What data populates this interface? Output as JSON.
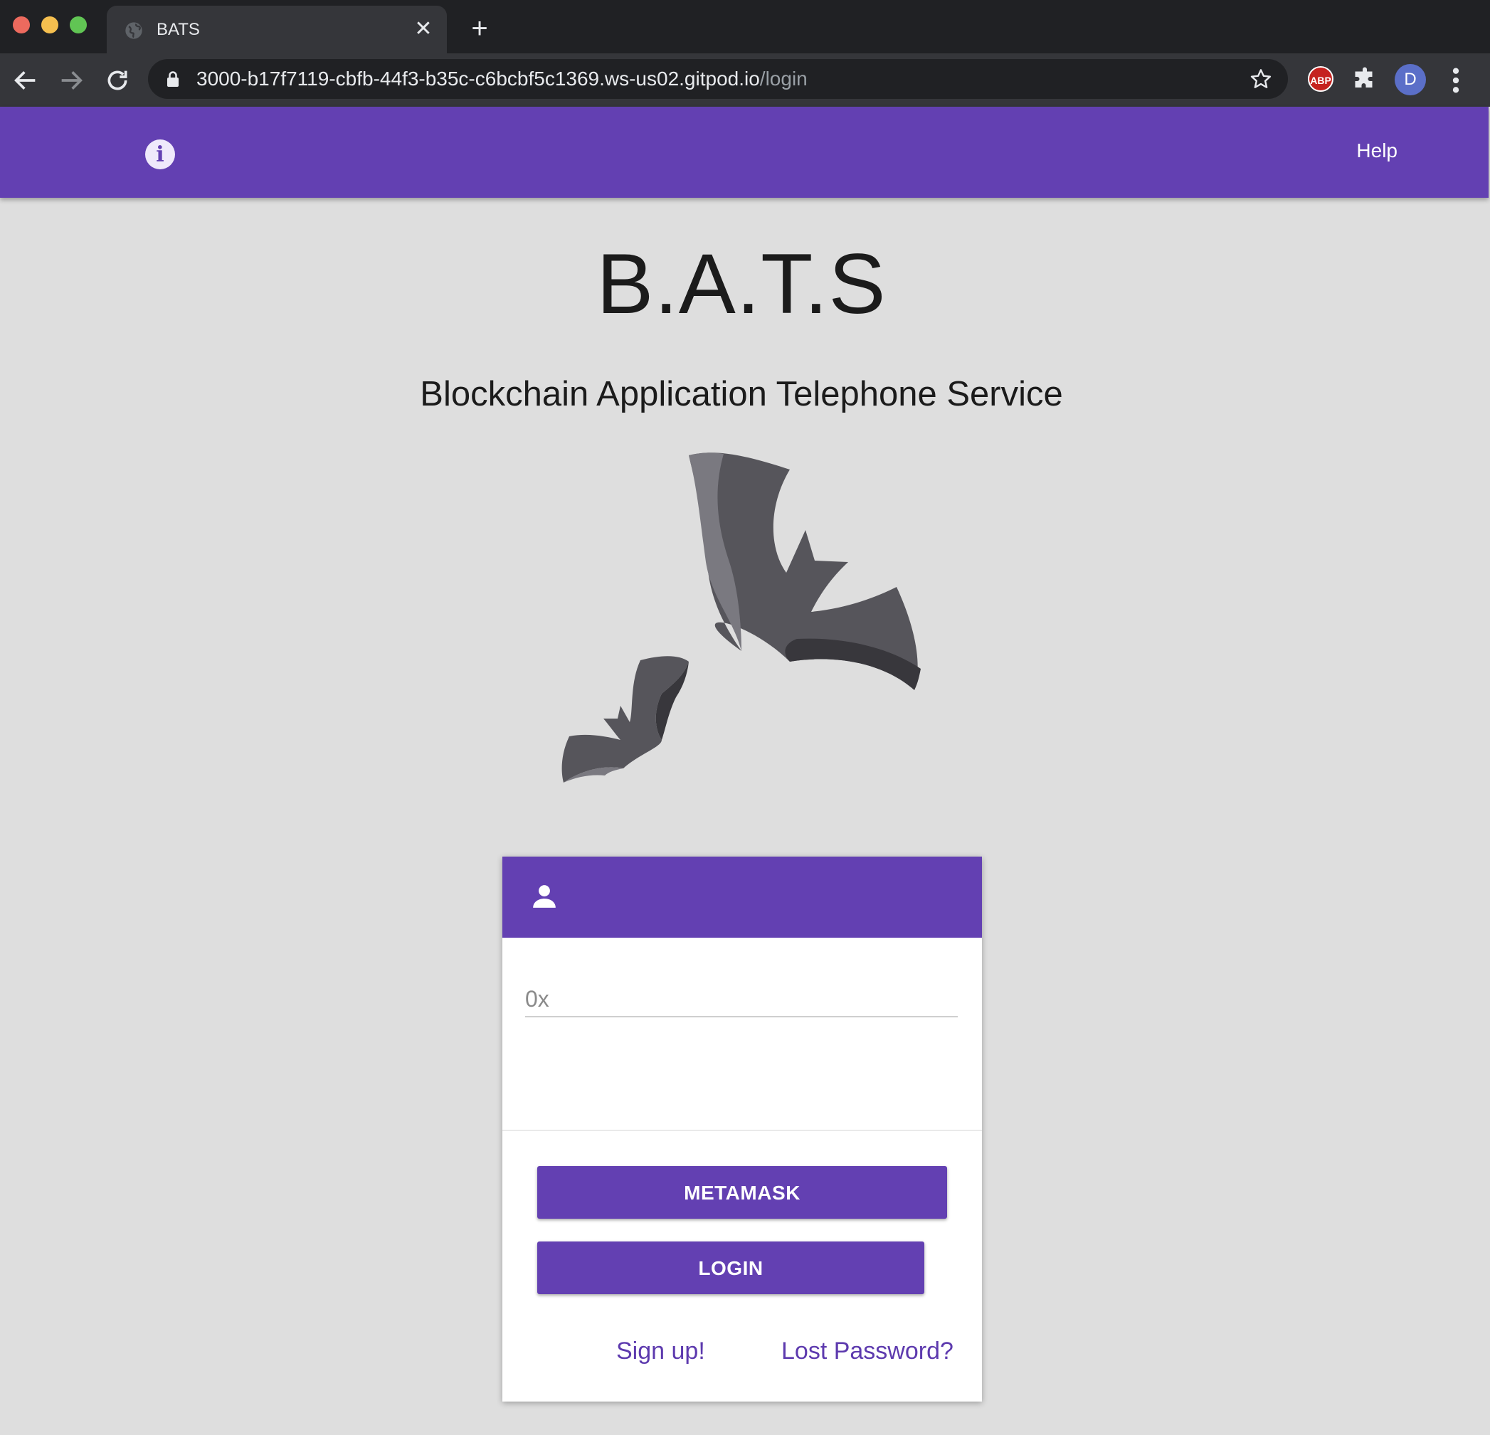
{
  "browser": {
    "tab_title": "BATS",
    "tab_close": "✕",
    "new_tab": "+",
    "url_host": "3000-b17f7119-cbfb-44f3-b35c-c6bcbf5c1369.ws-us02.gitpod.io",
    "url_path": "/login",
    "extension_abp": "ABP",
    "profile_initial": "D",
    "icons": [
      "back-icon",
      "forward-icon",
      "reload-icon",
      "lock-icon",
      "star-icon",
      "puzzle-icon",
      "kebab-menu-icon"
    ]
  },
  "appbar": {
    "info_glyph": "i",
    "help_label": "Help",
    "color": "#6340b2"
  },
  "hero": {
    "title": "B.A.T.S",
    "subtitle": "Blockchain Application Telephone Service",
    "logo_icon": "bats-logo-icon"
  },
  "login_card": {
    "header_icon": "user-icon",
    "address_placeholder": "0x",
    "address_value": "",
    "metamask_label": "METAMASK",
    "login_label": "LOGIN",
    "signup_label": "Sign up!",
    "lost_password_label": "Lost Password?"
  },
  "colors": {
    "accent": "#6340b2",
    "page_background": "#dedede",
    "link": "#5d3aae"
  }
}
